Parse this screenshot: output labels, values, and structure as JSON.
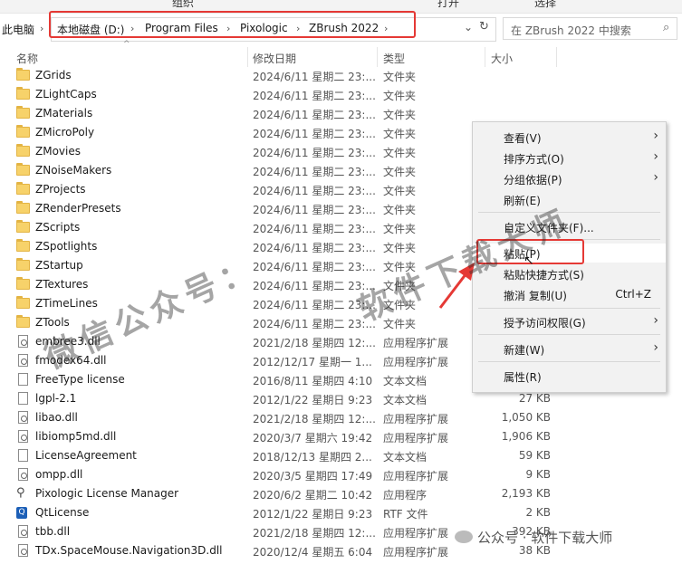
{
  "ribbon": [
    "组织",
    "打开",
    "选择"
  ],
  "address": {
    "this_pc": "此电脑",
    "crumbs": [
      "本地磁盘 (D:)",
      "Program Files",
      "Pixologic",
      "ZBrush 2022"
    ],
    "search_placeholder": "在 ZBrush 2022 中搜索"
  },
  "columns": {
    "name": "名称",
    "date": "修改日期",
    "type": "类型",
    "size": "大小"
  },
  "files": [
    {
      "name": "ZGrids",
      "date": "2024/6/11 星期二 23:...",
      "type": "文件夹",
      "size": "",
      "icon": "folder-icon"
    },
    {
      "name": "ZLightCaps",
      "date": "2024/6/11 星期二 23:...",
      "type": "文件夹",
      "size": "",
      "icon": "folder-icon"
    },
    {
      "name": "ZMaterials",
      "date": "2024/6/11 星期二 23:...",
      "type": "文件夹",
      "size": "",
      "icon": "folder-icon"
    },
    {
      "name": "ZMicroPoly",
      "date": "2024/6/11 星期二 23:...",
      "type": "文件夹",
      "size": "",
      "icon": "folder-icon"
    },
    {
      "name": "ZMovies",
      "date": "2024/6/11 星期二 23:...",
      "type": "文件夹",
      "size": "",
      "icon": "folder-icon"
    },
    {
      "name": "ZNoiseMakers",
      "date": "2024/6/11 星期二 23:...",
      "type": "文件夹",
      "size": "",
      "icon": "folder-icon"
    },
    {
      "name": "ZProjects",
      "date": "2024/6/11 星期二 23:...",
      "type": "文件夹",
      "size": "",
      "icon": "folder-icon"
    },
    {
      "name": "ZRenderPresets",
      "date": "2024/6/11 星期二 23:...",
      "type": "文件夹",
      "size": "",
      "icon": "folder-icon"
    },
    {
      "name": "ZScripts",
      "date": "2024/6/11 星期二 23:...",
      "type": "文件夹",
      "size": "",
      "icon": "folder-icon"
    },
    {
      "name": "ZSpotlights",
      "date": "2024/6/11 星期二 23:...",
      "type": "文件夹",
      "size": "",
      "icon": "folder-icon"
    },
    {
      "name": "ZStartup",
      "date": "2024/6/11 星期二 23:...",
      "type": "文件夹",
      "size": "",
      "icon": "folder-icon"
    },
    {
      "name": "ZTextures",
      "date": "2024/6/11 星期二 23:...",
      "type": "文件夹",
      "size": "",
      "icon": "folder-icon"
    },
    {
      "name": "ZTimeLines",
      "date": "2024/6/11 星期二 23:...",
      "type": "文件夹",
      "size": "",
      "icon": "folder-icon"
    },
    {
      "name": "ZTools",
      "date": "2024/6/11 星期二 23:...",
      "type": "文件夹",
      "size": "",
      "icon": "folder-icon"
    },
    {
      "name": "embree3.dll",
      "date": "2021/2/18 星期四 12:...",
      "type": "应用程序扩展",
      "size": "",
      "icon": "dll-icon"
    },
    {
      "name": "fmodex64.dll",
      "date": "2012/12/17 星期一 1...",
      "type": "应用程序扩展",
      "size": "",
      "icon": "dll-icon"
    },
    {
      "name": "FreeType license",
      "date": "2016/8/11 星期四 4:10",
      "type": "文本文档",
      "size": "",
      "icon": "text-file-icon"
    },
    {
      "name": "lgpl-2.1",
      "date": "2012/1/22 星期日 9:23",
      "type": "文本文档",
      "size": "27 KB",
      "icon": "text-file-icon"
    },
    {
      "name": "libao.dll",
      "date": "2021/2/18 星期四 12:...",
      "type": "应用程序扩展",
      "size": "1,050 KB",
      "icon": "dll-icon"
    },
    {
      "name": "libiomp5md.dll",
      "date": "2020/3/7 星期六 19:42",
      "type": "应用程序扩展",
      "size": "1,906 KB",
      "icon": "dll-icon"
    },
    {
      "name": "LicenseAgreement",
      "date": "2018/12/13 星期四 2...",
      "type": "文本文档",
      "size": "59 KB",
      "icon": "text-file-icon"
    },
    {
      "name": "ompp.dll",
      "date": "2020/3/5 星期四 17:49",
      "type": "应用程序扩展",
      "size": "9 KB",
      "icon": "dll-icon"
    },
    {
      "name": "Pixologic License Manager",
      "date": "2020/6/2 星期二 10:42",
      "type": "应用程序",
      "size": "2,193 KB",
      "icon": "app-icon"
    },
    {
      "name": "QtLicense",
      "date": "2012/1/22 星期日 9:23",
      "type": "RTF 文件",
      "size": "2 KB",
      "icon": "rtf-icon"
    },
    {
      "name": "tbb.dll",
      "date": "2021/2/18 星期四 12:...",
      "type": "应用程序扩展",
      "size": "392 KB",
      "icon": "dll-icon"
    },
    {
      "name": "TDx.SpaceMouse.Navigation3D.dll",
      "date": "2020/12/4 星期五 6:04",
      "type": "应用程序扩展",
      "size": "38 KB",
      "icon": "dll-icon"
    }
  ],
  "context_menu": {
    "view": "查看(V)",
    "sort": "排序方式(O)",
    "group": "分组依据(P)",
    "refresh": "刷新(E)",
    "customize": "自定义文件夹(F)...",
    "paste": "粘贴(P)",
    "paste_shortcut": "粘贴快捷方式(S)",
    "undo": "撤消 复制(U)",
    "undo_shortcut": "Ctrl+Z",
    "access": "授予访问权限(G)",
    "new": "新建(W)",
    "properties": "属性(R)"
  },
  "watermarks": {
    "diagonal_left": "微信公众号：",
    "diagonal_right": "软件下载大师",
    "footer": "公众号 · 软件下载大师"
  },
  "colors": {
    "highlight_box": "#e53935",
    "folder": "#f7d26a"
  }
}
